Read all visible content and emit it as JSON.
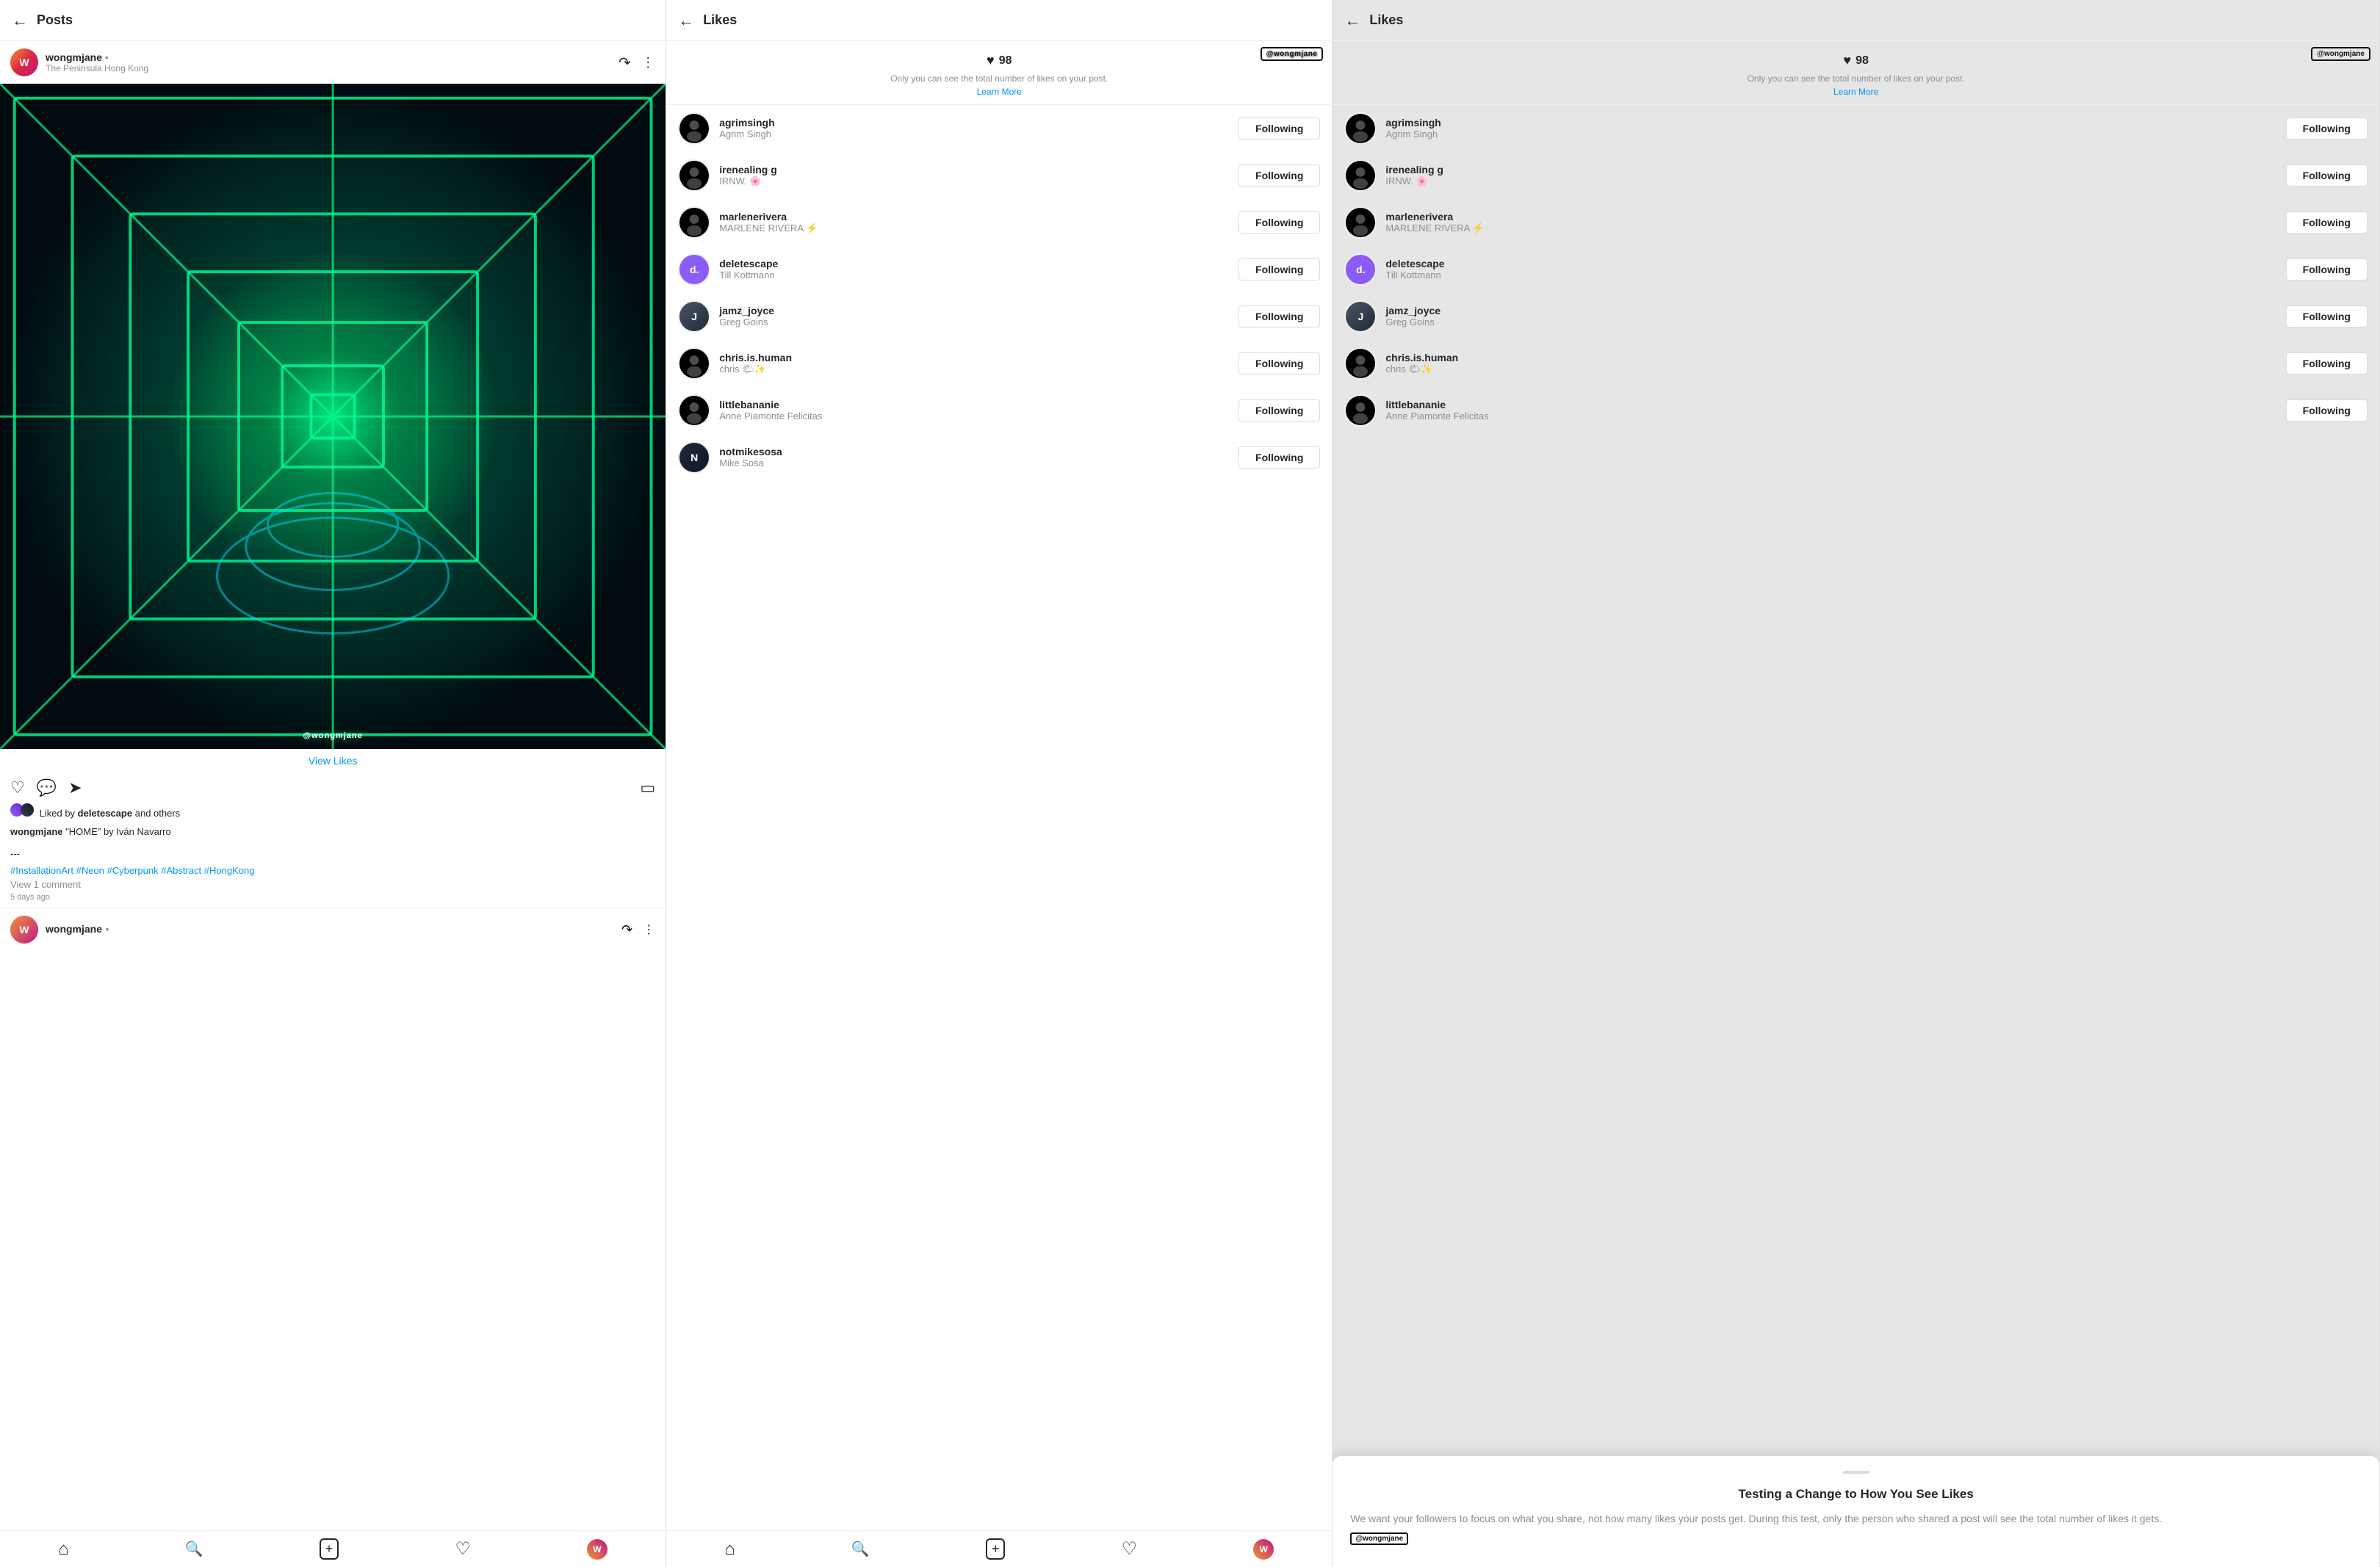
{
  "panels": {
    "panel1": {
      "title": "Posts",
      "username": "wongmjane",
      "subtitle": "The Peninsula Hong Kong",
      "dot": "•",
      "caption_quote": "\"HOME\" by Iván Navarro",
      "caption_prefix": "wongmjane",
      "caption_dashes": "---",
      "hashtags": "#InstallationArt #Neon #Cyberpunk #Abstract #HongKong",
      "view_likes": "View Likes",
      "liked_by_text": "Liked by",
      "liked_by_user": "deletescape",
      "liked_by_suffix": "and others",
      "view_comment": "View 1 comment",
      "time_ago": "5 days ago",
      "watermark": "@wongmjane",
      "second_post_username": "wongmjane",
      "second_post_dot": "•"
    },
    "panel2": {
      "title": "Likes",
      "likes_count": "98",
      "likes_sub": "Only you can see the total number of likes on your post.",
      "learn_more": "Learn More",
      "watermark": "@wongmjane",
      "users": [
        {
          "username": "agrimsingh",
          "fullname": "Agrim Singh",
          "btn": "Following",
          "avatar_type": "img1"
        },
        {
          "username": "irenealing g",
          "fullname": "IRNW. 🌸",
          "btn": "Following",
          "avatar_type": "img2"
        },
        {
          "username": "marlenerivera",
          "fullname": "MARLENE RIVERA ⚡",
          "btn": "Following",
          "avatar_type": "img3"
        },
        {
          "username": "deletescape",
          "fullname": "Till Kottmann",
          "btn": "Following",
          "avatar_type": "purple_d"
        },
        {
          "username": "jamz_joyce",
          "fullname": "Greg Goins",
          "btn": "Following",
          "avatar_type": "img4"
        },
        {
          "username": "chris.is.human",
          "fullname": "chris 🌤✨",
          "btn": "Following",
          "avatar_type": "img5"
        },
        {
          "username": "littlebananie",
          "fullname": "Anne Piamonte Felicitas",
          "btn": "Following",
          "avatar_type": "img6"
        },
        {
          "username": "notmikesosa",
          "fullname": "Mike Sosa",
          "btn": "Following",
          "avatar_type": "img7"
        }
      ]
    },
    "panel3": {
      "title": "Likes",
      "likes_count": "98",
      "likes_sub": "Only you can see the total number of likes on your post.",
      "learn_more": "Learn More",
      "watermark": "@wongmjane",
      "users": [
        {
          "username": "agrimsingh",
          "fullname": "Agrim Singh",
          "btn": "Following",
          "avatar_type": "img1"
        },
        {
          "username": "irenealing g",
          "fullname": "IRNW. 🌸",
          "btn": "Following",
          "avatar_type": "img2"
        },
        {
          "username": "marlenerivera",
          "fullname": "MARLENE RIVERA ⚡",
          "btn": "Following",
          "avatar_type": "img3"
        },
        {
          "username": "deletescape",
          "fullname": "Till Kottmann",
          "btn": "Following",
          "avatar_type": "purple_d"
        },
        {
          "username": "jamz_joyce",
          "fullname": "Greg Goins",
          "btn": "Following",
          "avatar_type": "img4"
        },
        {
          "username": "chris.is.human",
          "fullname": "chris 🌤✨",
          "btn": "Following",
          "avatar_type": "img5"
        },
        {
          "username": "littlebananie",
          "fullname": "Anne Piamonte Felicitas",
          "btn": "Following",
          "avatar_type": "img6"
        }
      ],
      "popup_title": "Testing a Change to How You See Likes",
      "popup_text": "We want your followers to focus on what you share, not how many likes your posts get. During this test, only the person who shared a post will see the total number of likes it gets.",
      "popup_watermark": "@wongmjane"
    }
  },
  "nav": {
    "home": "⌂",
    "search": "🔍",
    "add": "+",
    "heart": "♡",
    "profile": ""
  }
}
